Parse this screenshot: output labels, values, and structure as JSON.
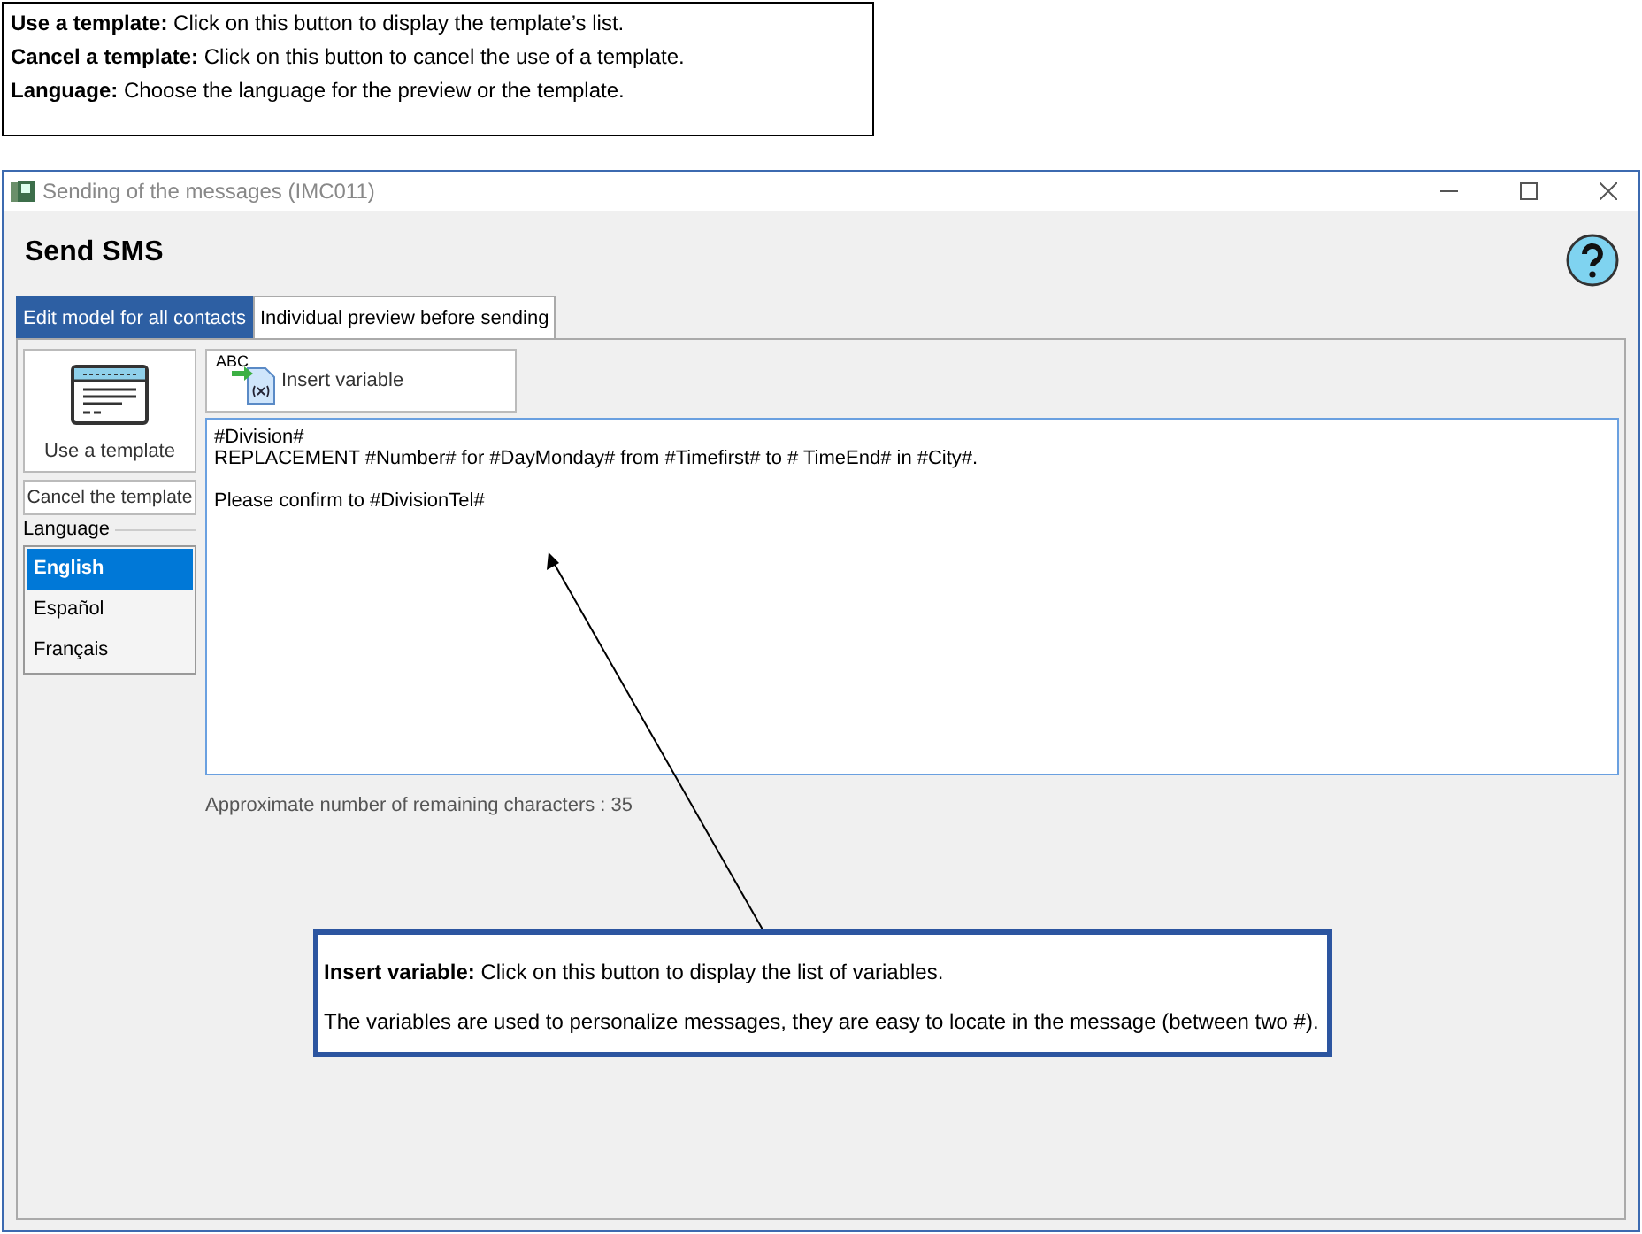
{
  "help_notes": [
    "**Use a template:** Click on this button to display the template’s list.",
    "**Cancel a template:** Click on this button to cancel the use of a template.",
    "**Language:** Choose the language for the preview or the template."
  ],
  "window": {
    "title": "Sending of the messages (IMC011)"
  },
  "heading": "Send SMS",
  "tabs": [
    {
      "label": "Edit model for all contacts",
      "selected": true
    },
    {
      "label": "Individual preview before sending",
      "selected": false
    }
  ],
  "use_template_button": "Use a template",
  "cancel_template_button": "Cancel the template",
  "language": {
    "label": "Language",
    "options": [
      {
        "label": "English",
        "selected": true
      },
      {
        "label": "Español",
        "selected": false
      },
      {
        "label": "Français",
        "selected": false
      }
    ]
  },
  "insert_variable_button": {
    "icon_text": "ABC",
    "label": "Insert variable"
  },
  "message_paragraphs": [
    [
      "#Division#",
      "REPLACEMENT #Number# for #DayMonday# from #Timefirst# to # TimeEnd# in #City#."
    ],
    [
      "Please confirm to #DivisionTel#"
    ]
  ],
  "remaining_characters": "Approximate number of remaining characters : 35",
  "callout": [
    "**Insert variable:** Click on this button to display the list of variables.",
    "The variables are used to personalize messages, they are easy to locate in the message (between two #)."
  ]
}
